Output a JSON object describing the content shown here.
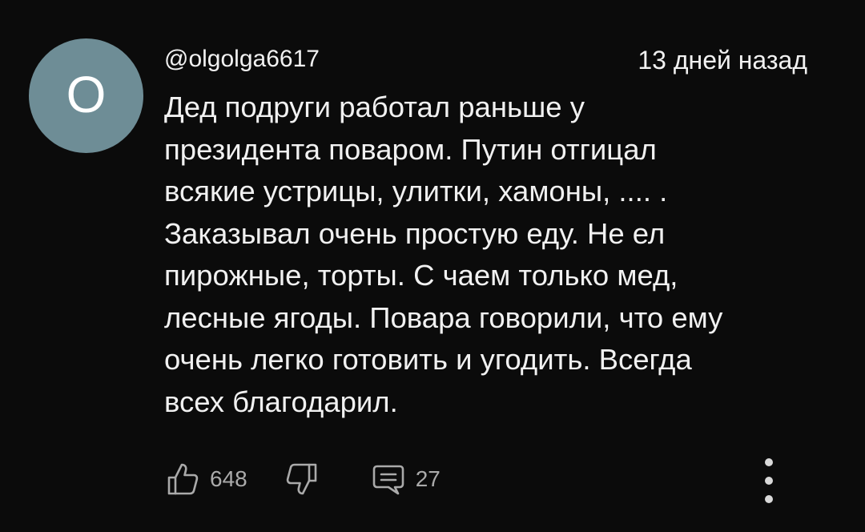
{
  "comment": {
    "avatar_letter": "O",
    "author": "@olgolga6617",
    "timestamp": "13 дней назад",
    "text": "Дед подруги работал раньше у\nпрезидента поваром. Путин отгицал\nвсякие устрицы, улитки, хамоны, .... .\nЗаказывал очень простую еду. Не ел\nпирожные,  торты. С чаем только мед,\nлесные ягоды. Повара говорили, что ему\nочень легко готовить и угодить. Всегда\nвсех благодарил.",
    "likes": "648",
    "replies": "27"
  },
  "icons": {
    "like": "thumbs-up-icon",
    "dislike": "thumbs-down-icon",
    "reply": "comment-icon",
    "menu": "more-vert-icon"
  },
  "colors": {
    "background": "#0b0b0b",
    "avatar": "#6e8d96",
    "text": "#f1f1f1",
    "secondary_text": "#aaaaaa"
  }
}
